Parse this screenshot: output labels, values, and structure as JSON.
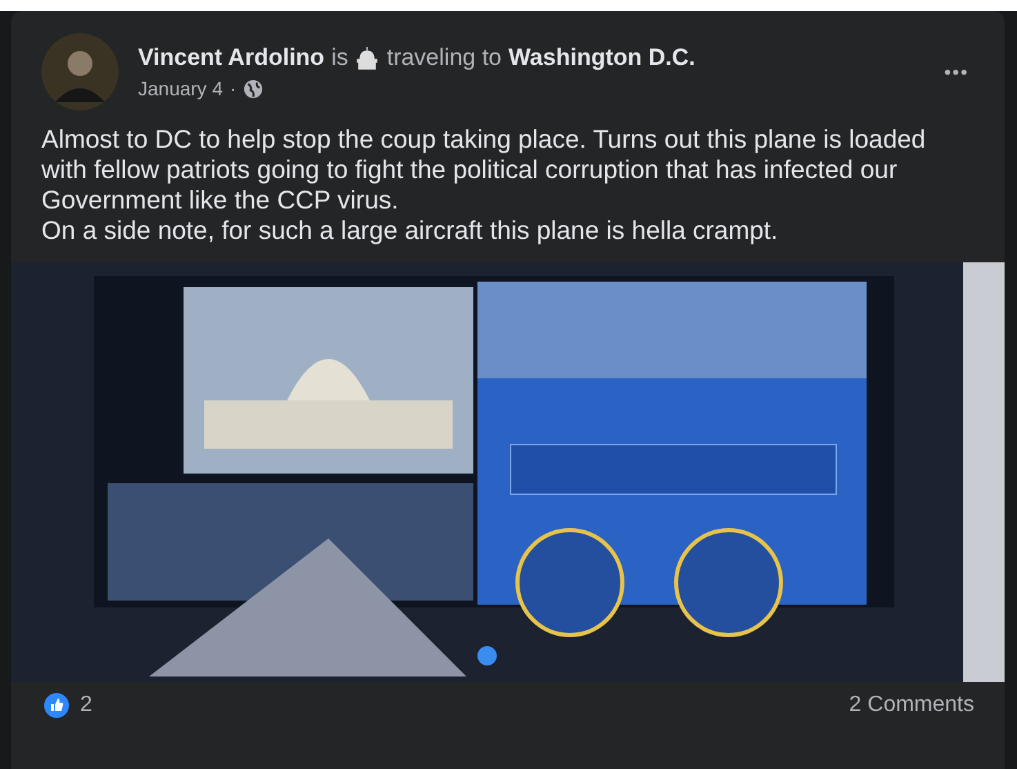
{
  "post": {
    "author": "Vincent Ardolino",
    "verb": "is",
    "activity": "traveling to",
    "place": "Washington D.C.",
    "date": "January 4",
    "separator": "·",
    "menu": "•••",
    "text": "Almost to DC to help stop the coup taking place. Turns out this plane is loaded with fellow patriots going to fight the political corruption that has infected our Government like the CCP virus.\nOn a side note, for such a large aircraft this plane is hella crampt.",
    "reactions": {
      "count": "2"
    },
    "comments": "2 Comments"
  }
}
